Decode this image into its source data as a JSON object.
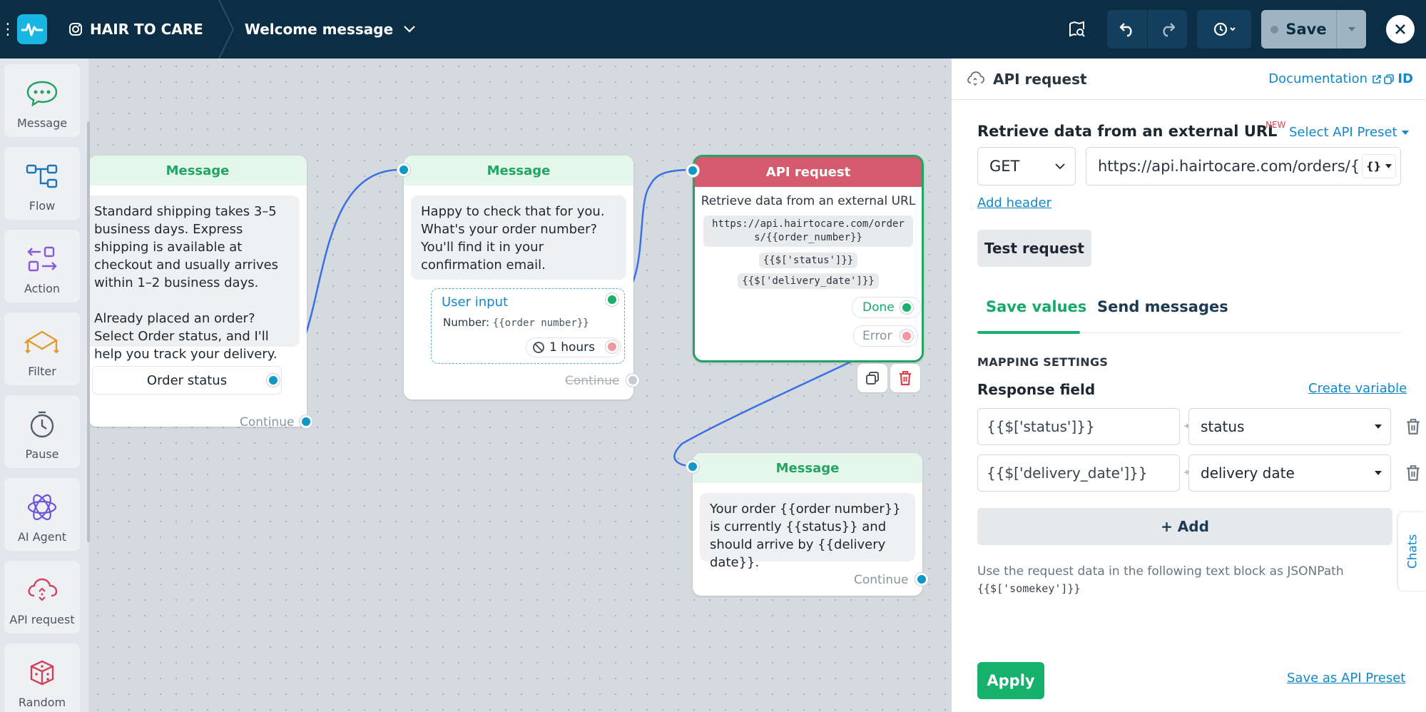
{
  "topbar": {
    "brand": "HAIR TO CARE",
    "flow_name": "Welcome message",
    "save_label": "Save"
  },
  "sidebar": {
    "items": [
      {
        "label": "Message",
        "icon": "message-icon"
      },
      {
        "label": "Flow",
        "icon": "flow-icon"
      },
      {
        "label": "Action",
        "icon": "action-icon"
      },
      {
        "label": "Filter",
        "icon": "filter-icon"
      },
      {
        "label": "Pause",
        "icon": "pause-icon"
      },
      {
        "label": "AI Agent",
        "icon": "ai-agent-icon"
      },
      {
        "label": "API request",
        "icon": "api-request-icon"
      },
      {
        "label": "Random",
        "icon": "random-icon"
      }
    ]
  },
  "canvas": {
    "node1": {
      "title": "Message",
      "text1": "Standard shipping takes 3–5 business days. Express shipping is available at checkout and usually arrives within 1–2 business days.",
      "text2": "Already placed an order? Select Order status, and I'll help you track your delivery.",
      "button": "Order status",
      "continue": "Continue"
    },
    "node2": {
      "title": "Message",
      "text": "Happy to check that for you. What's your order number? You'll find it in your confirmation email.",
      "user_input_title": "User input",
      "user_input_label": "Number:",
      "user_input_var": "{{order number}}",
      "timeout": "1 hours",
      "continue": "Continue"
    },
    "node3": {
      "title": "API request",
      "desc": "Retrieve data from an external URL",
      "url": "https://api.hairtocare.com/orders/{{order_number}}",
      "var1": "{{$['status']}}",
      "var2": "{{$['delivery_date']}}",
      "done": "Done",
      "error": "Error"
    },
    "node4": {
      "title": "Message",
      "text": "Your order {{order number}} is currently {{status}} and should arrive by {{delivery date}}.",
      "continue": "Continue"
    }
  },
  "panel": {
    "title": "API request",
    "documentation": "Documentation",
    "id_label": "ID",
    "heading": "Retrieve data from an external URL",
    "new_badge": "NEW",
    "select_preset": "Select API Preset",
    "method": "GET",
    "url": "https://api.hairtocare.com/orders/{{order_number}}",
    "add_header": "Add header",
    "test_request": "Test request",
    "tabs": [
      "Save values",
      "Send messages"
    ],
    "mapping_title": "MAPPING SETTINGS",
    "response_field": "Response field",
    "create_variable": "Create variable",
    "mappings": [
      {
        "path": "{{$['status']}}",
        "variable": "status"
      },
      {
        "path": "{{$['delivery_date']}}",
        "variable": "delivery date"
      }
    ],
    "add_label": "+ Add",
    "hint": "Use the request data in the following text block as JSONPath",
    "hint_code": "{{$['somekey']}}",
    "apply": "Apply",
    "save_preset": "Save as API Preset",
    "chats_tab": "Chats"
  },
  "colors": {
    "topbar": "#0b2e45",
    "accent_green": "#17b16e",
    "link_blue": "#1188c7",
    "api_red": "#d55a6d",
    "wire_blue": "#3b6fe6"
  }
}
